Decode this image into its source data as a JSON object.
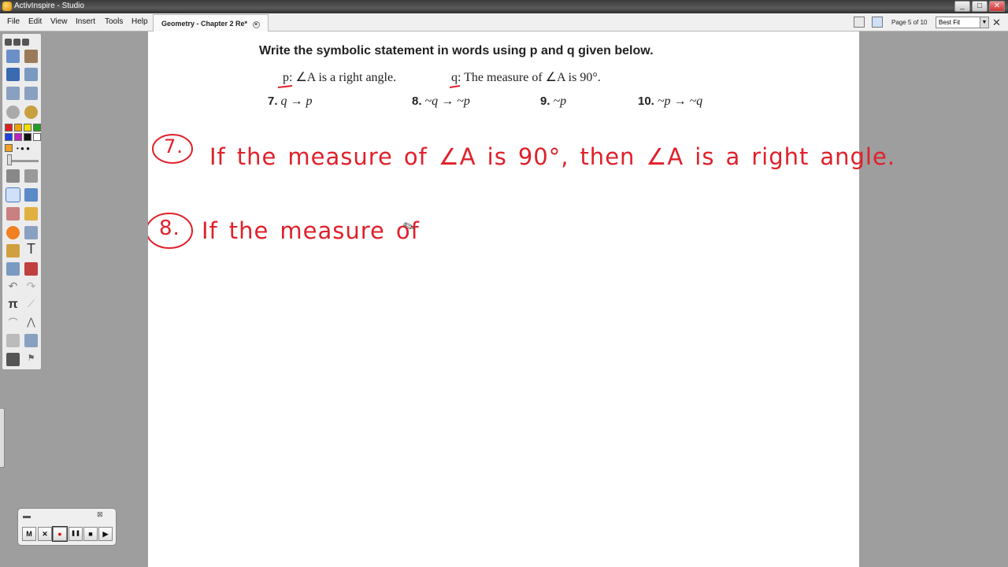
{
  "window": {
    "title": "ActivInspire - Studio",
    "buttons": [
      "_",
      "□",
      "✕"
    ]
  },
  "menu": [
    "File",
    "Edit",
    "View",
    "Insert",
    "Tools",
    "Help"
  ],
  "doc_tab": {
    "label": "Geometry - Chapter 2 Re*",
    "close": "×"
  },
  "page_nav": {
    "indicator": "Page 5 of 10",
    "zoom": "Best Fit"
  },
  "colors": {
    "ink": "#e0202a",
    "toolbox_selected": "#cfe0f8"
  },
  "palette": [
    "#e02020",
    "#f0a000",
    "#f0e000",
    "#20a020",
    "#2040e0",
    "#c020c0",
    "#111111",
    "#ffffff"
  ],
  "tools": [
    "desktop-annotate",
    "notebook",
    "gallery",
    "search",
    "previous-page",
    "next-page",
    "home",
    "cursor",
    "select",
    "pen",
    "highlighter",
    "eraser",
    "fill",
    "shape",
    "connector",
    "magic-ink",
    "text",
    "spotlight",
    "revealer",
    "undo",
    "redo",
    "math",
    "line",
    "compass",
    "ruler",
    "device",
    "camera",
    "trash"
  ],
  "recorder": {
    "buttons": [
      "M",
      "✕",
      "●",
      "❚❚",
      "■",
      "▶"
    ]
  },
  "page": {
    "heading": "Write the symbolic statement in words using p and q given below.",
    "p_def": "p: ∠A is a right angle.",
    "q_def": "q: The measure of ∠A is 90°.",
    "problems": [
      {
        "num": "7.",
        "expr": "q → p"
      },
      {
        "num": "8.",
        "expr": "~q → ~p"
      },
      {
        "num": "9.",
        "expr": "~p"
      },
      {
        "num": "10.",
        "expr": "~p → ~q"
      }
    ],
    "answer7": {
      "label": "7.",
      "words": [
        "If",
        "the",
        "measure",
        "of",
        "∠A",
        "is",
        "90°,",
        "then",
        "∠A",
        "is",
        "a",
        "right",
        "angle."
      ]
    },
    "answer8": {
      "label": "8.",
      "words": [
        "If",
        "the",
        "measure",
        "of"
      ]
    }
  }
}
